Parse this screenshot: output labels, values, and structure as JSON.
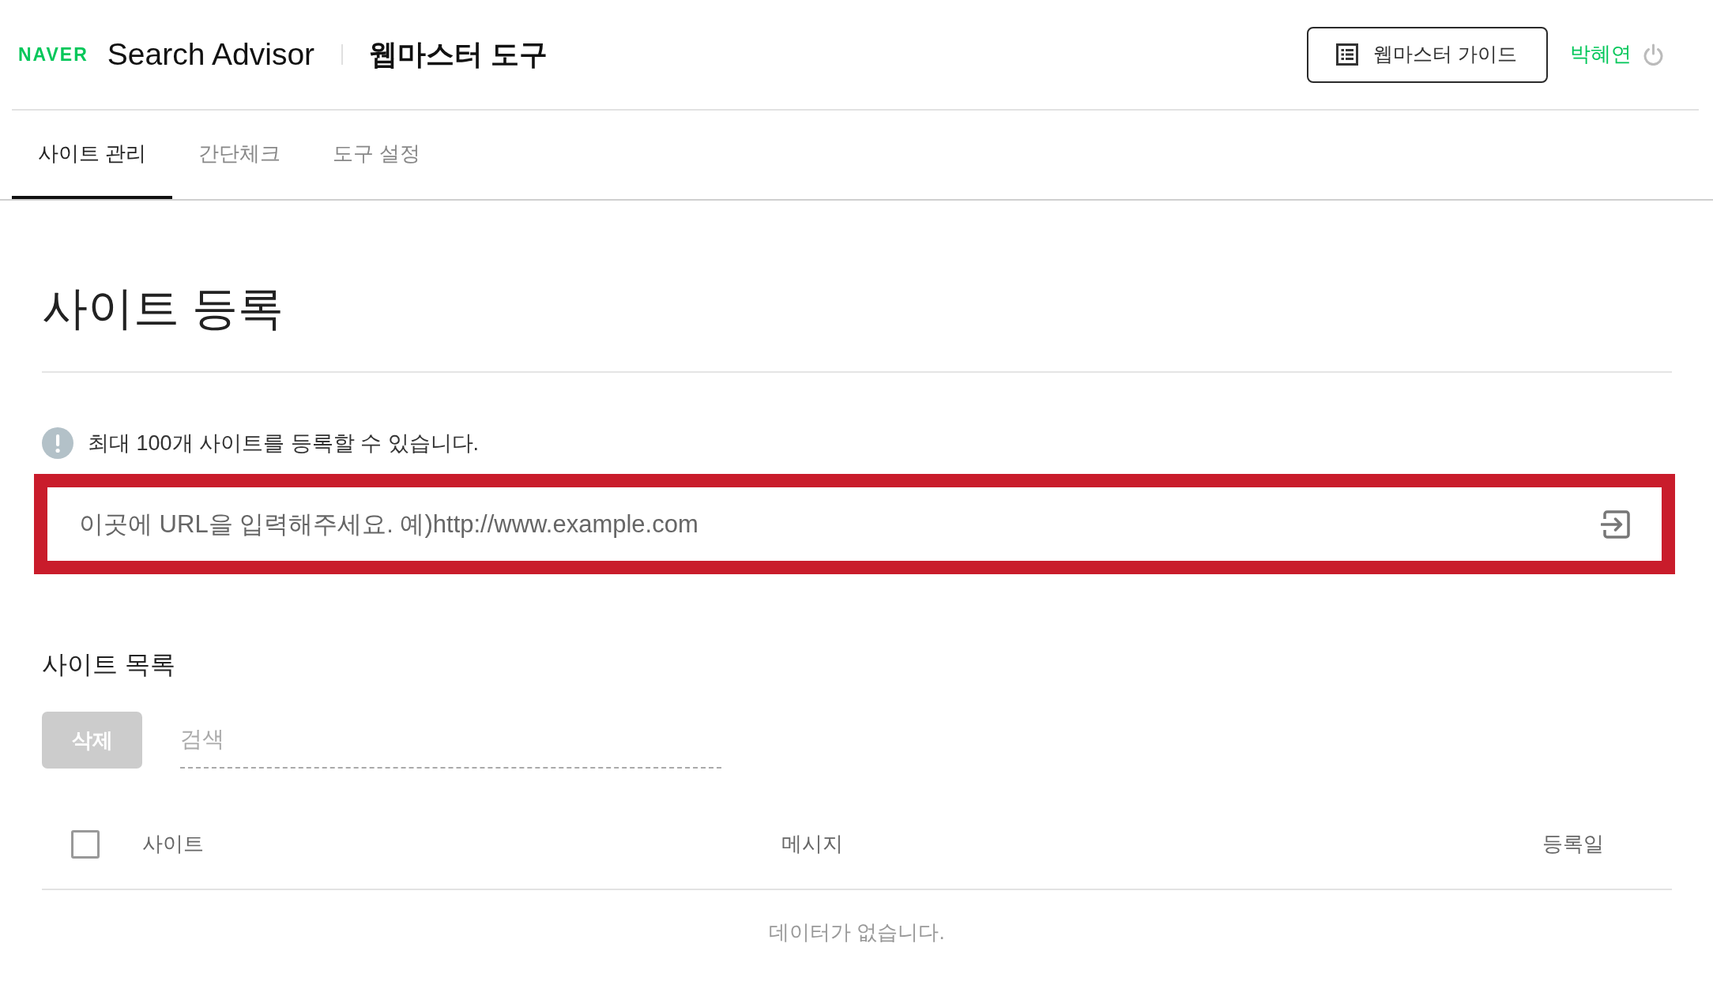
{
  "header": {
    "logo": "NAVER",
    "product": "Search Advisor",
    "title": "웹마스터 도구",
    "guide_button": "웹마스터 가이드",
    "user_name": "박혜연"
  },
  "tabs": [
    {
      "label": "사이트 관리",
      "selected": true
    },
    {
      "label": "간단체크",
      "selected": false
    },
    {
      "label": "도구 설정",
      "selected": false
    }
  ],
  "register": {
    "title": "사이트 등록",
    "notice": "최대 100개 사이트를 등록할 수 있습니다.",
    "url_field": {
      "placeholder": "이곳에 URL을 입력해주세요. 예)http://www.example.com",
      "highlighted": true
    }
  },
  "site_list": {
    "title": "사이트 목록",
    "delete_button": {
      "label": "삭제",
      "disabled": true
    },
    "search": {
      "placeholder": "검색"
    },
    "table": {
      "select_all": {
        "checked": false
      },
      "columns": [
        "사이트",
        "메시지",
        "등록일"
      ],
      "empty_message": "데이터가 없습니다."
    }
  }
}
